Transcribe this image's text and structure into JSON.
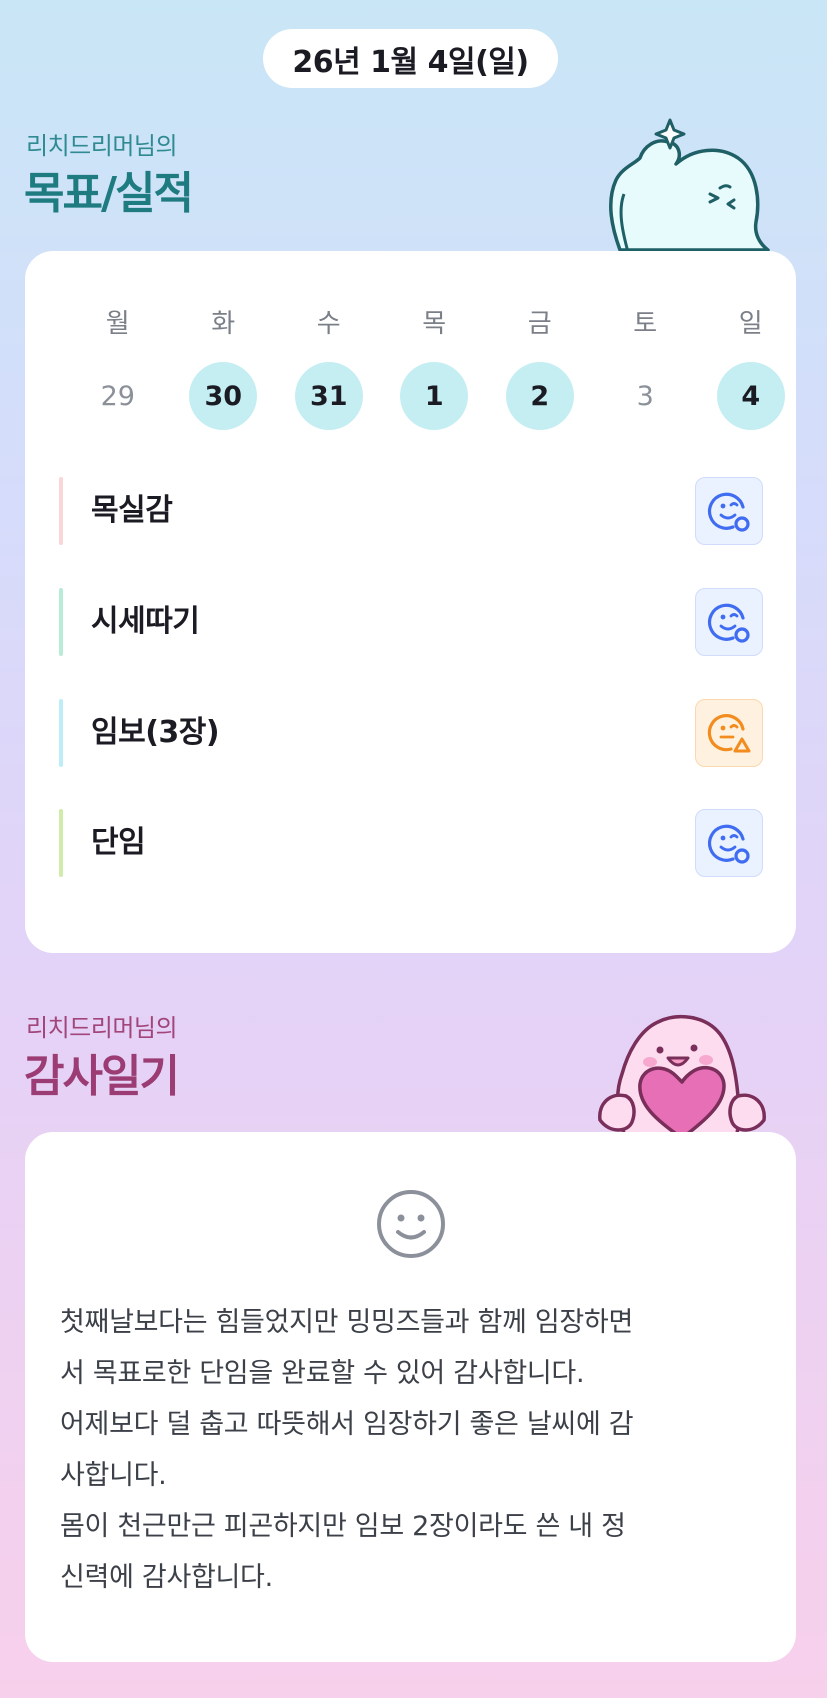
{
  "header": {
    "date": "26년 1월 4일(일)"
  },
  "goals_section": {
    "subtitle": "리치드리머님의",
    "title": "목표/실적",
    "weekdays": [
      "월",
      "화",
      "수",
      "목",
      "금",
      "토",
      "일"
    ],
    "dates": [
      {
        "day": "29",
        "achieved": false
      },
      {
        "day": "30",
        "achieved": true
      },
      {
        "day": "31",
        "achieved": true
      },
      {
        "day": "1",
        "achieved": true
      },
      {
        "day": "2",
        "achieved": true
      },
      {
        "day": "3",
        "achieved": false
      },
      {
        "day": "4",
        "achieved": true
      }
    ],
    "items": [
      {
        "name": "목실감",
        "bar_color": "#fbd6d6",
        "status_icon": "smile-check-icon",
        "status_color": "#3f6cf0"
      },
      {
        "name": "시세따기",
        "bar_color": "#b8ecd7",
        "status_icon": "smile-check-icon",
        "status_color": "#3f6cf0"
      },
      {
        "name": "임보(3장)",
        "bar_color": "#bdeef8",
        "status_icon": "smile-warning-icon",
        "status_color": "#f28c1e"
      },
      {
        "name": "단임",
        "bar_color": "#cfecab",
        "status_icon": "smile-check-icon",
        "status_color": "#3f6cf0"
      }
    ]
  },
  "thanks_section": {
    "subtitle": "리치드리머님의",
    "title": "감사일기",
    "lines": [
      "첫째날보다는 힘들었지만 밍밍즈들과 함께 임장하면",
      "서 목표로한 단임을 완료할 수 있어 감사합니다.",
      "어제보다 덜 춥고 따뜻해서 임장하기 좋은 날씨에 감",
      "사합니다.",
      "몸이 천근만근 피곤하지만 임보 2장이라도 쓴 내 정",
      "신력에 감사합니다."
    ]
  }
}
